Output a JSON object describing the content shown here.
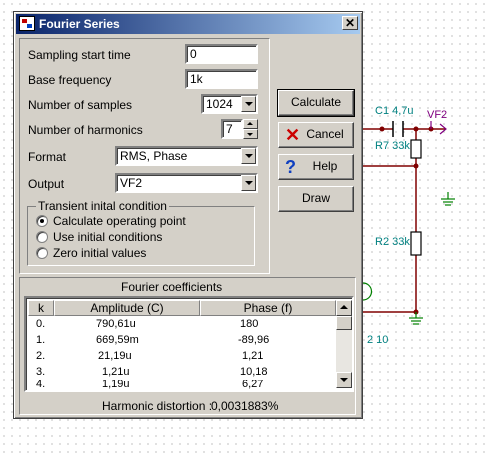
{
  "schematic": {
    "labels": {
      "c1": "C1 4,7u",
      "vf2": "VF2",
      "r7": "R7 33k",
      "r2": "R2 33k",
      "partial": "2 10"
    }
  },
  "dialog": {
    "title": "Fourier Series",
    "close_glyph": "✕",
    "fields": {
      "sampling_start_time": {
        "label": "Sampling start time",
        "value": "0"
      },
      "base_frequency": {
        "label": "Base frequency",
        "value": "1k"
      },
      "number_of_samples": {
        "label": "Number of samples",
        "value": "1024"
      },
      "number_of_harmonics": {
        "label": "Number of harmonics",
        "value": "7"
      },
      "format": {
        "label": "Format",
        "value": "RMS, Phase"
      },
      "output": {
        "label": "Output",
        "value": "VF2"
      }
    },
    "buttons": {
      "calculate": "Calculate",
      "cancel": "Cancel",
      "help": "Help",
      "draw": "Draw"
    },
    "icons": {
      "cancel": "red-x-icon",
      "help": "question-mark-icon"
    },
    "transient": {
      "title": "Transient inital condition",
      "options": [
        {
          "label": "Calculate operating point",
          "selected": true
        },
        {
          "label": "Use initial conditions",
          "selected": false
        },
        {
          "label": "Zero initial values",
          "selected": false
        }
      ]
    },
    "fourier": {
      "title": "Fourier coefficients",
      "columns": [
        "k",
        "Amplitude (C)",
        "Phase (f)"
      ],
      "rows": [
        {
          "k": "0.",
          "amplitude": "790,61u",
          "phase": "180"
        },
        {
          "k": "1.",
          "amplitude": "669,59m",
          "phase": "-89,96"
        },
        {
          "k": "2.",
          "amplitude": "21,19u",
          "phase": "1,21"
        },
        {
          "k": "3.",
          "amplitude": "1,21u",
          "phase": "10,18"
        },
        {
          "k": "4.",
          "amplitude": "1,19u",
          "phase": "6,27"
        }
      ],
      "distortion_label": "Harmonic distortion :",
      "distortion_value": "0,0031883%"
    }
  },
  "colors": {
    "title_start": "#0a246a",
    "title_end": "#a6caf0",
    "dialog_bg": "#d4d0c8",
    "wire": "#800000",
    "label_cyan": "#008080",
    "label_purple": "#800080",
    "ground_green": "#008000"
  }
}
